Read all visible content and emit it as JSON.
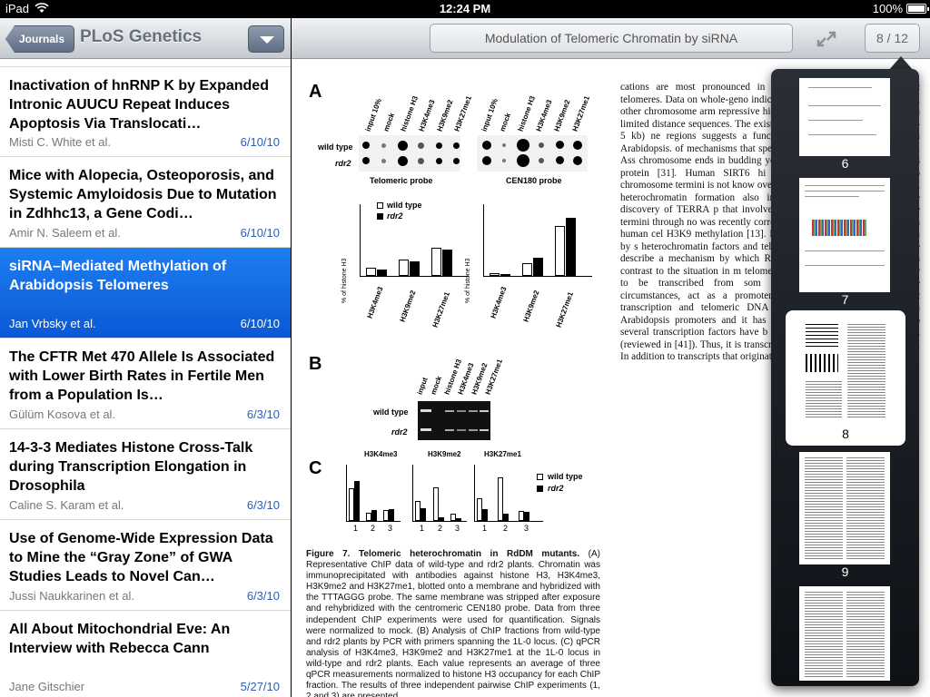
{
  "status": {
    "carrier": "iPad",
    "time": "12:24 PM",
    "battery": "100%"
  },
  "left": {
    "back_label": "Journals",
    "journal_title": "PLoS Genetics",
    "articles": [
      {
        "title": "Inactivation of hnRNP K by Expanded Intronic AUUCU Repeat Induces Apoptosis Via Translocati…",
        "author": "Misti C. White et al.",
        "date": "6/10/10"
      },
      {
        "title": "Mice with Alopecia, Osteoporosis, and Systemic Amyloidosis Due to Mutation in Zdhhc13, a Gene Codi…",
        "author": "Amir N. Saleem et al.",
        "date": "6/10/10"
      },
      {
        "title": "siRNA–Mediated Methylation of Arabidopsis Telomeres",
        "author": "Jan Vrbsky et al.",
        "date": "6/10/10"
      },
      {
        "title": "The CFTR Met 470 Allele Is Associated with Lower Birth Rates in Fertile Men from a Population Is…",
        "author": "Gülüm Kosova et al.",
        "date": "6/3/10"
      },
      {
        "title": "14-3-3 Mediates Histone Cross-Talk during Transcription Elongation in Drosophila",
        "author": "Caline S. Karam et al.",
        "date": "6/3/10"
      },
      {
        "title": "Use of Genome-Wide Expression Data to Mine the “Gray Zone” of GWA Studies Leads to Novel Can…",
        "author": "Jussi Naukkarinen et al.",
        "date": "6/3/10"
      },
      {
        "title": "All About Mitochondrial Eve: An Interview with Rebecca Cann",
        "author": "Jane Gitschier",
        "date": "5/27/10"
      }
    ]
  },
  "right": {
    "doc_title": "Modulation of Telomeric Chromatin by siRNA",
    "page_counter": "8 / 12"
  },
  "figure": {
    "panel_a": "A",
    "panel_b": "B",
    "panel_c": "C",
    "a_columns": [
      "input 10%",
      "mock",
      "histone H3",
      "H3K4me3",
      "H3K9me2",
      "H3K27me1"
    ],
    "row_wild_type": "wild type",
    "row_rdr2": "rdr2",
    "probe_telomeric": "Telomeric probe",
    "probe_cen180": "CEN180 probe",
    "legend_wild_type": "wild type",
    "legend_rdr2": "rdr2",
    "ylabel": "% of histone H3",
    "a_bar_x": [
      "H3K4me3",
      "H3K9me2",
      "H3K27me1"
    ],
    "b_columns": [
      "input",
      "mock",
      "histone H3",
      "H3K4me3",
      "H3K9me2",
      "H3K27me1"
    ],
    "c_titles": [
      "H3K4me3",
      "H3K9me2",
      "H3K27me1"
    ],
    "c_x": [
      "1",
      "2",
      "3"
    ]
  },
  "caption": {
    "bold": "Figure 7. Telomeric heterochromatin in RdDM mutants.",
    "text": " (A) Representative ChIP data of wild-type and rdr2 plants. Chromatin was immunoprecipitated with antibodies against histone H3, H3K4me3, H3K9me2 and H3K27me1, blotted onto a membrane and hybridized with the TTTAGGG probe. The same membrane was stripped after exposure and rehybridized with the centromeric CEN180 probe. Data from three independent ChIP experiments were used for quantification. Signals were normalized to mock. (B) Analysis of ChIP fractions from wild-type and rdr2 plants by PCR with primers spanning the 1L-0 locus. (C) qPCR analysis of H3K4me3, H3K9me2 and H3K27me1 at the 1L-0 locus in wild-type and rdr2 plants. Each value represents an average of three qPCR measurements normalized to histone H3 occupancy for each ChIP fraction. The results of three independent pairwise ChIP experiments (1, 2 and 3) are presented."
  },
  "bodytext": "cations are most pronounced in that their presence gradually rec telomeres. Data on whole-geno indicate that this also holds true f several other chromosome arm repressive histone marks are prima spread only a limited distance sequences. The existence of su repressive chromatin (2–5 kb) ne regions suggests a functional imp zation of telomeres in Arabidopsis. of mechanisms that specifically modifications at telomeres. Ass chromosome ends in budding ye tethering Sir proteins to telomeres protein [31]. Human SIRT6 hi associates with telomeres, altho chromosome termini is not know overexpressing TRF2 indicates th yeast, heterochromatin formation also involve telomere-binding pro The discovery of TERRA p that involves targeting the chrom chromosome termini through no was recently corroborated by the TERRA by RNAi in human cel H3K9 methylation [13]. It was pr heterochromatin formation by s heterochromatin factors and telo demonstrate expression of telome describe a mechanism by which RNAs affect telomeric chromatin In contrast to the situation in m telomeric transcripts were detected appear to be transcribed from som indicates that canonical telome circumstances, act as a promoter lines of observations further c transcription and telomeric DNA stretches of a telomeric sequen Arabidopsis promoters and it has b telomere motifs are required fo several transcription factors have b specifically bind to telomeric DNA (reviewed in [41]). Thus, it is transcription factors localize to expression. In addition to transcripts that originated at telomeres, we",
  "thumbnails": {
    "pages": [
      "6",
      "7",
      "8",
      "9"
    ],
    "selected": "8"
  },
  "colors": {
    "selection": "#1d6ef0",
    "date": "#2a5fb8"
  }
}
